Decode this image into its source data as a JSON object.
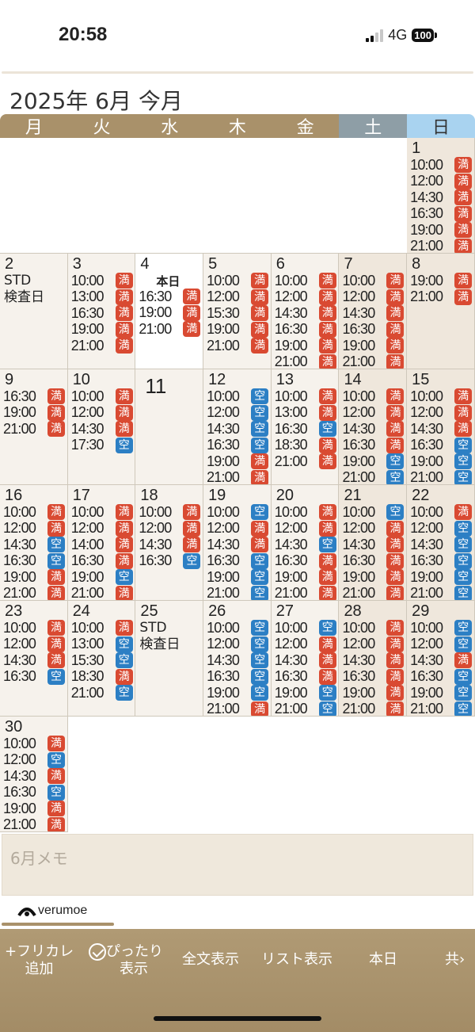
{
  "status": {
    "time": "20:58",
    "network": "4G",
    "battery": "100"
  },
  "title": "2025年 6月 今月",
  "weekdays": [
    "月",
    "火",
    "水",
    "木",
    "金",
    "土",
    "日"
  ],
  "legend": {
    "full": "満",
    "open": "空"
  },
  "today_label": "本日",
  "weeks": [
    [
      null,
      null,
      null,
      null,
      null,
      null,
      {
        "day": "1",
        "slots": [
          [
            "10:00",
            "満"
          ],
          [
            "12:00",
            "満"
          ],
          [
            "14:30",
            "満"
          ],
          [
            "16:30",
            "満"
          ],
          [
            "19:00",
            "満"
          ],
          [
            "21:00",
            "満"
          ]
        ]
      }
    ],
    [
      {
        "day": "2",
        "note": [
          "STD",
          "検査日"
        ]
      },
      {
        "day": "3",
        "slots": [
          [
            "10:00",
            "満"
          ],
          [
            "13:00",
            "満"
          ],
          [
            "16:30",
            "満"
          ],
          [
            "19:00",
            "満"
          ],
          [
            "21:00",
            "満"
          ]
        ]
      },
      {
        "day": "4",
        "today": true,
        "slots": [
          [
            "16:30",
            "満"
          ],
          [
            "19:00",
            "満"
          ],
          [
            "21:00",
            "満"
          ]
        ]
      },
      {
        "day": "5",
        "slots": [
          [
            "10:00",
            "満"
          ],
          [
            "12:00",
            "満"
          ],
          [
            "15:30",
            "満"
          ],
          [
            "19:00",
            "満"
          ],
          [
            "21:00",
            "満"
          ]
        ]
      },
      {
        "day": "6",
        "slots": [
          [
            "10:00",
            "満"
          ],
          [
            "12:00",
            "満"
          ],
          [
            "14:30",
            "満"
          ],
          [
            "16:30",
            "満"
          ],
          [
            "19:00",
            "満"
          ],
          [
            "21:00",
            "満"
          ]
        ]
      },
      {
        "day": "7",
        "slots": [
          [
            "10:00",
            "満"
          ],
          [
            "12:00",
            "満"
          ],
          [
            "14:30",
            "満"
          ],
          [
            "16:30",
            "満"
          ],
          [
            "19:00",
            "満"
          ],
          [
            "21:00",
            "満"
          ]
        ]
      },
      {
        "day": "8",
        "slots": [
          [
            "19:00",
            "満"
          ],
          [
            "21:00",
            "満"
          ]
        ]
      }
    ],
    [
      {
        "day": "9",
        "slots": [
          [
            "16:30",
            "満"
          ],
          [
            "19:00",
            "満"
          ],
          [
            "21:00",
            "満"
          ]
        ]
      },
      {
        "day": "10",
        "slots": [
          [
            "10:00",
            "満"
          ],
          [
            "12:00",
            "満"
          ],
          [
            "14:30",
            "満"
          ],
          [
            "17:30",
            "空"
          ]
        ]
      },
      {
        "day": "11",
        "big": true
      },
      {
        "day": "12",
        "slots": [
          [
            "10:00",
            "空"
          ],
          [
            "12:00",
            "空"
          ],
          [
            "14:30",
            "空"
          ],
          [
            "16:30",
            "空"
          ],
          [
            "19:00",
            "満"
          ],
          [
            "21:00",
            "満"
          ]
        ]
      },
      {
        "day": "13",
        "slots": [
          [
            "10:00",
            "満"
          ],
          [
            "13:00",
            "満"
          ],
          [
            "16:30",
            "空"
          ],
          [
            "18:30",
            "満"
          ],
          [
            "21:00",
            "満"
          ]
        ]
      },
      {
        "day": "14",
        "slots": [
          [
            "10:00",
            "満"
          ],
          [
            "12:00",
            "満"
          ],
          [
            "14:30",
            "満"
          ],
          [
            "16:30",
            "満"
          ],
          [
            "19:00",
            "空"
          ],
          [
            "21:00",
            "空"
          ]
        ]
      },
      {
        "day": "15",
        "slots": [
          [
            "10:00",
            "満"
          ],
          [
            "12:00",
            "満"
          ],
          [
            "14:30",
            "満"
          ],
          [
            "16:30",
            "空"
          ],
          [
            "19:00",
            "空"
          ],
          [
            "21:00",
            "空"
          ]
        ]
      }
    ],
    [
      {
        "day": "16",
        "slots": [
          [
            "10:00",
            "満"
          ],
          [
            "12:00",
            "満"
          ],
          [
            "14:30",
            "空"
          ],
          [
            "16:30",
            "空"
          ],
          [
            "19:00",
            "満"
          ],
          [
            "21:00",
            "満"
          ]
        ]
      },
      {
        "day": "17",
        "slots": [
          [
            "10:00",
            "満"
          ],
          [
            "12:00",
            "満"
          ],
          [
            "14:00",
            "満"
          ],
          [
            "16:30",
            "満"
          ],
          [
            "19:00",
            "空"
          ],
          [
            "21:00",
            "満"
          ]
        ]
      },
      {
        "day": "18",
        "slots": [
          [
            "10:00",
            "満"
          ],
          [
            "12:00",
            "満"
          ],
          [
            "14:30",
            "満"
          ],
          [
            "16:30",
            "空"
          ]
        ]
      },
      {
        "day": "19",
        "slots": [
          [
            "10:00",
            "空"
          ],
          [
            "12:00",
            "満"
          ],
          [
            "14:30",
            "満"
          ],
          [
            "16:30",
            "空"
          ],
          [
            "19:00",
            "空"
          ],
          [
            "21:00",
            "空"
          ]
        ]
      },
      {
        "day": "20",
        "slots": [
          [
            "10:00",
            "満"
          ],
          [
            "12:00",
            "満"
          ],
          [
            "14:30",
            "空"
          ],
          [
            "16:30",
            "満"
          ],
          [
            "19:00",
            "満"
          ],
          [
            "21:00",
            "満"
          ]
        ]
      },
      {
        "day": "21",
        "slots": [
          [
            "10:00",
            "空"
          ],
          [
            "12:00",
            "満"
          ],
          [
            "14:30",
            "満"
          ],
          [
            "16:30",
            "満"
          ],
          [
            "19:00",
            "満"
          ],
          [
            "21:00",
            "満"
          ]
        ]
      },
      {
        "day": "22",
        "slots": [
          [
            "10:00",
            "満"
          ],
          [
            "12:00",
            "空"
          ],
          [
            "14:30",
            "空"
          ],
          [
            "16:30",
            "空"
          ],
          [
            "19:00",
            "空"
          ],
          [
            "21:00",
            "空"
          ]
        ]
      }
    ],
    [
      {
        "day": "23",
        "slots": [
          [
            "10:00",
            "満"
          ],
          [
            "12:00",
            "満"
          ],
          [
            "14:30",
            "満"
          ],
          [
            "16:30",
            "空"
          ]
        ]
      },
      {
        "day": "24",
        "slots": [
          [
            "10:00",
            "満"
          ],
          [
            "13:00",
            "空"
          ],
          [
            "15:30",
            "空"
          ],
          [
            "18:30",
            "満"
          ],
          [
            "21:00",
            "空"
          ]
        ]
      },
      {
        "day": "25",
        "note": [
          "STD",
          "検査日"
        ]
      },
      {
        "day": "26",
        "slots": [
          [
            "10:00",
            "空"
          ],
          [
            "12:00",
            "空"
          ],
          [
            "14:30",
            "空"
          ],
          [
            "16:30",
            "空"
          ],
          [
            "19:00",
            "空"
          ],
          [
            "21:00",
            "満"
          ]
        ]
      },
      {
        "day": "27",
        "slots": [
          [
            "10:00",
            "空"
          ],
          [
            "12:00",
            "満"
          ],
          [
            "14:30",
            "満"
          ],
          [
            "16:30",
            "満"
          ],
          [
            "19:00",
            "空"
          ],
          [
            "21:00",
            "空"
          ]
        ]
      },
      {
        "day": "28",
        "slots": [
          [
            "10:00",
            "満"
          ],
          [
            "12:00",
            "満"
          ],
          [
            "14:30",
            "満"
          ],
          [
            "16:30",
            "満"
          ],
          [
            "19:00",
            "満"
          ],
          [
            "21:00",
            "満"
          ]
        ]
      },
      {
        "day": "29",
        "slots": [
          [
            "10:00",
            "空"
          ],
          [
            "12:00",
            "空"
          ],
          [
            "14:30",
            "満"
          ],
          [
            "16:30",
            "空"
          ],
          [
            "19:00",
            "空"
          ],
          [
            "21:00",
            "空"
          ]
        ]
      }
    ],
    [
      {
        "day": "30",
        "slots": [
          [
            "10:00",
            "満"
          ],
          [
            "12:00",
            "空"
          ],
          [
            "14:30",
            "満"
          ],
          [
            "16:30",
            "空"
          ],
          [
            "19:00",
            "満"
          ],
          [
            "21:00",
            "満"
          ]
        ]
      },
      null,
      null,
      null,
      null,
      null,
      null
    ]
  ],
  "memo": {
    "placeholder": "6月メモ"
  },
  "logo": "verumoe",
  "toolbar": {
    "add": [
      "+フリカレ",
      "追加"
    ],
    "fit": [
      "ぴったり",
      "表示"
    ],
    "full_text": "全文表示",
    "list": "リスト表示",
    "today": "本日",
    "share": "共"
  },
  "colors": {
    "full": "#d94a32",
    "open": "#2c7fc4",
    "accent": "#a9916a"
  }
}
